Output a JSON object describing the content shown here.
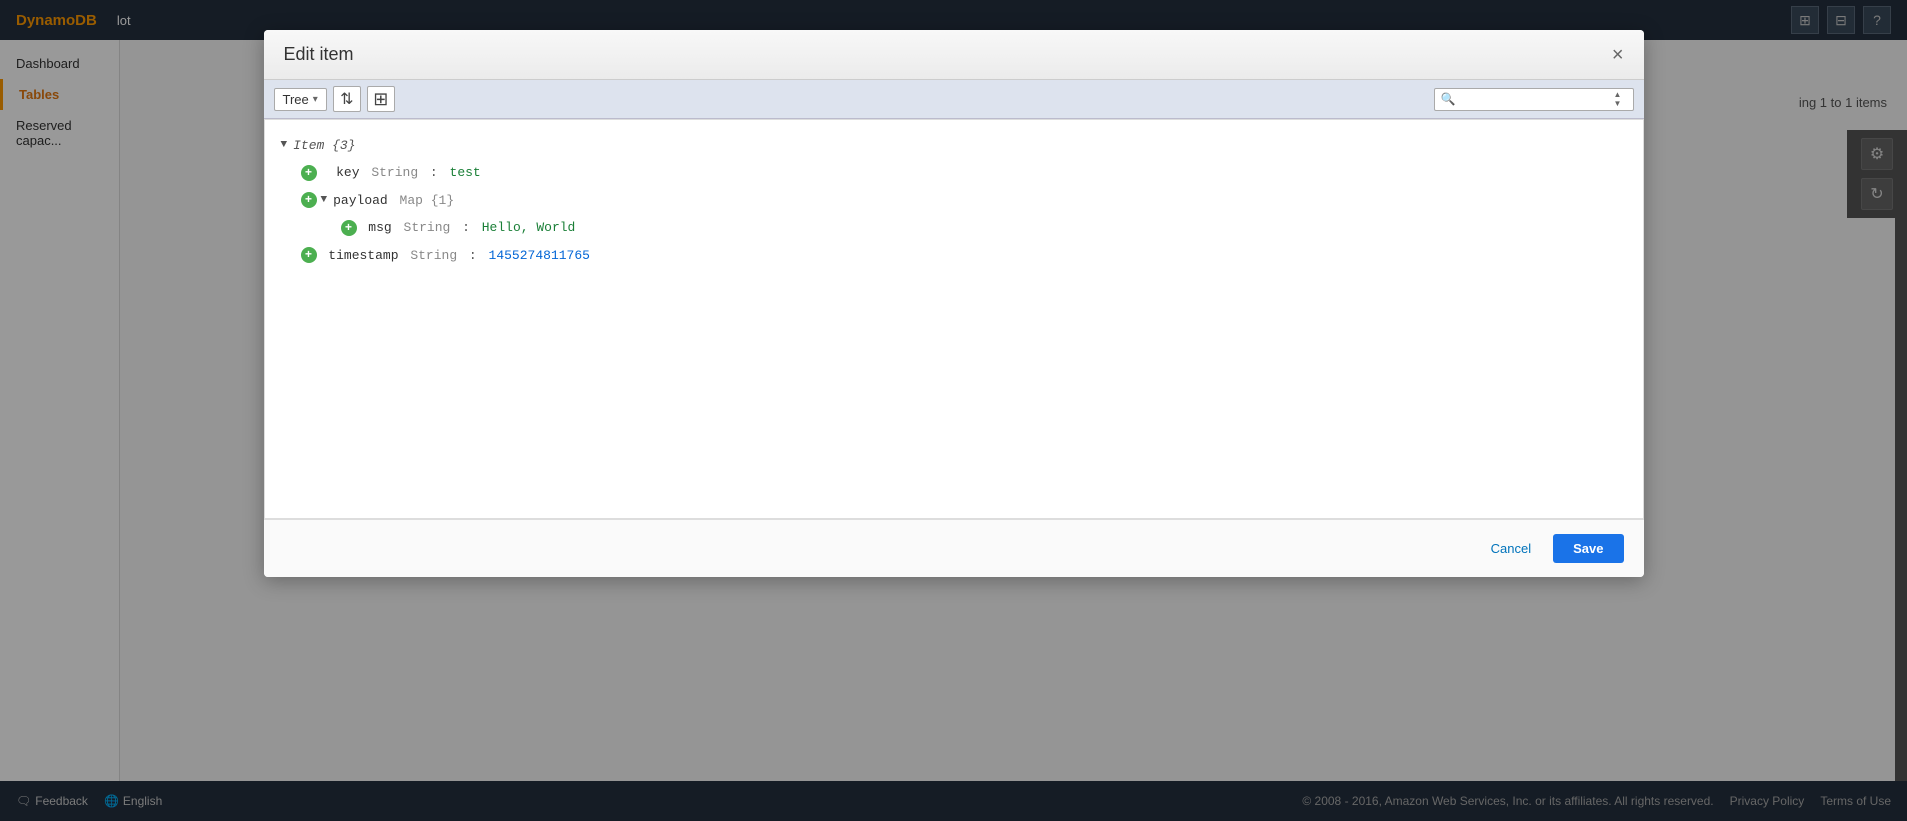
{
  "app": {
    "brand": "DynamoDB",
    "service_label": "lot"
  },
  "topnav": {
    "grid_icon": "⊞",
    "split_icon": "⊟",
    "help_icon": "?"
  },
  "sidebar": {
    "items": [
      {
        "label": "Dashboard",
        "active": false
      },
      {
        "label": "Tables",
        "active": true
      },
      {
        "label": "Reserved capac...",
        "active": false
      }
    ]
  },
  "items_count": "ing 1 to 1 items",
  "modal": {
    "title": "Edit item",
    "close_label": "×",
    "toolbar": {
      "view_label": "Tree",
      "dropdown_arrow": "▾",
      "expand_icon": "⇅",
      "add_icon": "⊞",
      "search_placeholder": ""
    },
    "tree": {
      "root": {
        "label": "Item {3}",
        "children": [
          {
            "key": "key",
            "type": "String",
            "value": "test",
            "value_color": "green",
            "indent": 1,
            "addable": true
          },
          {
            "key": "payload",
            "type": "Map {1}",
            "value": "",
            "indent": 1,
            "expandable": true,
            "addable": true,
            "children": [
              {
                "key": "msg",
                "type": "String",
                "value": "Hello, World",
                "value_color": "green",
                "indent": 2,
                "addable": true
              }
            ]
          },
          {
            "key": "timestamp",
            "type": "String",
            "value": "1455274811765",
            "value_color": "blue",
            "indent": 1,
            "addable": true
          }
        ]
      }
    },
    "footer": {
      "cancel_label": "Cancel",
      "save_label": "Save"
    }
  },
  "bottombar": {
    "feedback_label": "Feedback",
    "language_label": "English",
    "copyright": "© 2008 - 2016, Amazon Web Services, Inc. or its affiliates. All rights reserved.",
    "privacy_label": "Privacy Policy",
    "terms_label": "Terms of Use"
  }
}
